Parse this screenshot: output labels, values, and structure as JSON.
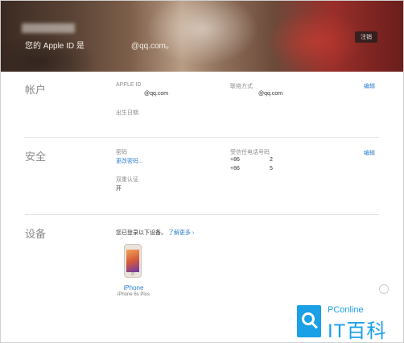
{
  "hero": {
    "apple_id_prefix": "您的 Apple ID 是",
    "email_suffix": "@qq.com。",
    "logout_label": "注销"
  },
  "account": {
    "title": "帐户",
    "apple_id_label": "APPLE ID",
    "apple_id_value": "@qq.com",
    "contact_label": "联络方式",
    "contact_value": "@qq.com",
    "birthday_label": "出生日期",
    "edit_label": "编辑"
  },
  "security": {
    "title": "安全",
    "password_label": "密码",
    "change_password_link": "更改密码...",
    "trusted_phone_label": "受信任电话号码",
    "phones": [
      {
        "code": "+86",
        "number": "2"
      },
      {
        "code": "+86",
        "number": "5"
      }
    ],
    "two_factor_label": "双重认证",
    "two_factor_value": "开",
    "edit_label": "编辑"
  },
  "devices": {
    "title": "设备",
    "intro": "您已登录以下设备。",
    "learn_more": "了解更多 ›",
    "items": [
      {
        "name": "iPhone",
        "model": "iPhone 6s Plus"
      }
    ]
  },
  "watermark": {
    "top": "PConline",
    "bottom": "IT百科"
  }
}
